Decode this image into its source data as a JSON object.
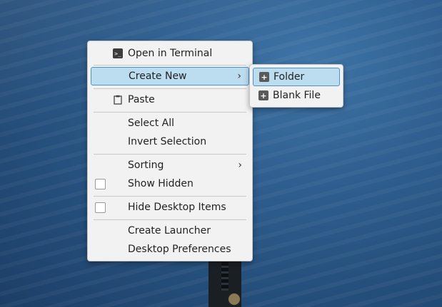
{
  "main_menu": {
    "open_terminal": "Open in Terminal",
    "create_new": "Create New",
    "paste": "Paste",
    "select_all": "Select All",
    "invert_selection": "Invert Selection",
    "sorting": "Sorting",
    "show_hidden": "Show Hidden",
    "hide_desktop_items": "Hide Desktop Items",
    "create_launcher": "Create Launcher",
    "desktop_preferences": "Desktop Preferences"
  },
  "submenu": {
    "folder": "Folder",
    "blank_file": "Blank File"
  },
  "icons": {
    "terminal": "terminal-icon",
    "paste": "clipboard-icon",
    "folder_new": "folder-plus-icon",
    "file_new": "file-plus-icon",
    "submenu_arrow": "chevron-right-icon",
    "checkbox": "checkbox-icon"
  },
  "colors": {
    "highlight_bg": "#bcdcf0",
    "highlight_border": "#4c93c8",
    "menu_bg": "#f2f2f2"
  }
}
